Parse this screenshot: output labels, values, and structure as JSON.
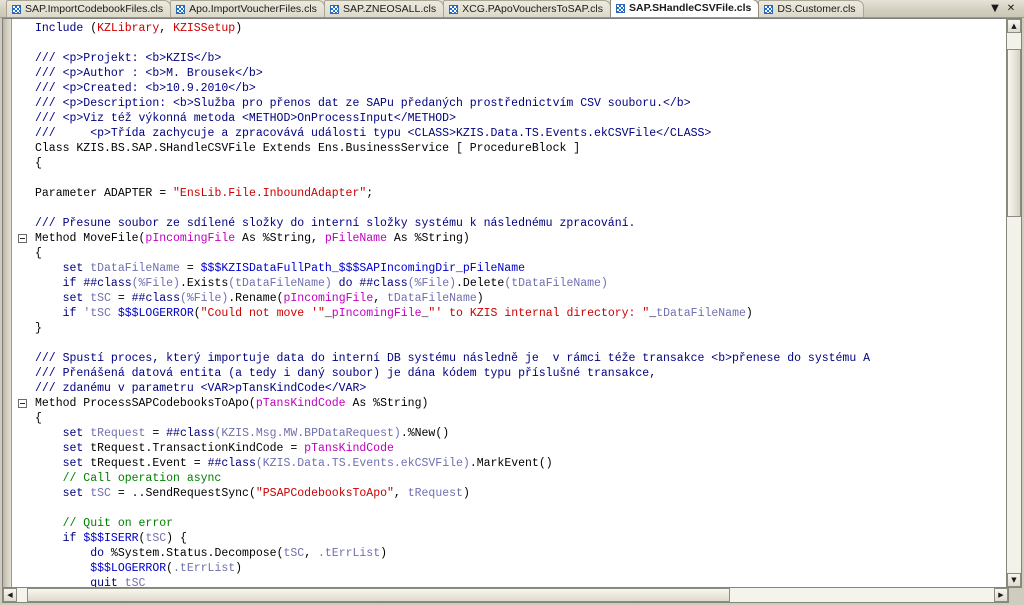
{
  "window": {
    "title": "SAP.SHandleCSVFile.cls"
  },
  "tabbar": {
    "tabs": [
      {
        "label": "SAP.ImportCodebookFiles.cls",
        "icon": "class-file-icon",
        "active": false
      },
      {
        "label": "Apo.ImportVoucherFiles.cls",
        "icon": "class-file-icon",
        "active": false
      },
      {
        "label": "SAP.ZNEOSALL.cls",
        "icon": "class-file-icon",
        "active": false
      },
      {
        "label": "XCG.PApoVouchersToSAP.cls",
        "icon": "class-file-icon",
        "active": false
      },
      {
        "label": "SAP.SHandleCSVFile.cls",
        "icon": "class-file-icon",
        "active": true
      },
      {
        "label": "DS.Customer.cls",
        "icon": "class-file-icon",
        "active": false
      }
    ],
    "tab_list_button": "▼",
    "close_button": "✕"
  },
  "scrollbars": {
    "vertical": {
      "up_arrow": "▲",
      "down_arrow": "▼",
      "thumb_top_pct": 3,
      "thumb_height_pct": 31
    },
    "horizontal": {
      "left_arrow": "◀",
      "right_arrow": "▶",
      "thumb_left_pct": 1,
      "thumb_width_pct": 72
    }
  },
  "colors": {
    "keyword": "#000080",
    "comment": "#008000",
    "doc_comment": "#000080",
    "string": "#cc0000",
    "macro": "#0000cc",
    "variable": "#c000c0",
    "classref": "#7070b0",
    "editor_background": "#ffffff",
    "chrome_background": "#d4d0c0",
    "active_tab_background": "#ffffff"
  },
  "code": {
    "language": "ObjectScript",
    "lines": [
      {
        "n": 1,
        "fold": false,
        "tokens": [
          {
            "t": "Include ",
            "c": "kw"
          },
          {
            "t": "(",
            "c": "plain"
          },
          {
            "t": "KZLibrary",
            "c": "str"
          },
          {
            "t": ", ",
            "c": "plain"
          },
          {
            "t": "KZISSetup",
            "c": "str"
          },
          {
            "t": ")",
            "c": "plain"
          }
        ]
      },
      {
        "n": 2,
        "fold": false,
        "tokens": []
      },
      {
        "n": 3,
        "fold": false,
        "tokens": [
          {
            "t": "/// <p>Projekt: <b>KZIS</b>",
            "c": "doc"
          }
        ]
      },
      {
        "n": 4,
        "fold": false,
        "tokens": [
          {
            "t": "/// <p>Author : <b>M. Brousek</b>",
            "c": "doc"
          }
        ]
      },
      {
        "n": 5,
        "fold": false,
        "tokens": [
          {
            "t": "/// <p>Created: <b>10.9.2010</b>",
            "c": "doc"
          }
        ]
      },
      {
        "n": 6,
        "fold": false,
        "tokens": [
          {
            "t": "/// <p>Description: <b>Služba pro přenos dat ze SAPu předaných prostřednictvím CSV souboru.</b>",
            "c": "doc"
          }
        ]
      },
      {
        "n": 7,
        "fold": false,
        "tokens": [
          {
            "t": "/// <p>Viz též výkonná metoda <METHOD>OnProcessInput</METHOD>",
            "c": "doc"
          }
        ]
      },
      {
        "n": 8,
        "fold": false,
        "tokens": [
          {
            "t": "///     <p>Třída zachycuje a zpracovává události typu <CLASS>KZIS.Data.TS.Events.ekCSVFile</CLASS>",
            "c": "doc"
          }
        ]
      },
      {
        "n": 9,
        "fold": false,
        "tokens": [
          {
            "t": "Class KZIS.BS.SAP.SHandleCSVFile Extends Ens.BusinessService [ ProcedureBlock ]",
            "c": "plain"
          }
        ]
      },
      {
        "n": 10,
        "fold": false,
        "tokens": [
          {
            "t": "{",
            "c": "plain"
          }
        ]
      },
      {
        "n": 11,
        "fold": false,
        "tokens": []
      },
      {
        "n": 12,
        "fold": false,
        "tokens": [
          {
            "t": "Parameter ADAPTER = ",
            "c": "plain"
          },
          {
            "t": "\"EnsLib.File.InboundAdapter\"",
            "c": "str"
          },
          {
            "t": ";",
            "c": "plain"
          }
        ]
      },
      {
        "n": 13,
        "fold": false,
        "tokens": []
      },
      {
        "n": 14,
        "fold": false,
        "tokens": [
          {
            "t": "/// Přesune soubor ze sdílené složky do interní složky systému k následnému zpracování.",
            "c": "doc"
          }
        ]
      },
      {
        "n": 15,
        "fold": true,
        "tokens": [
          {
            "t": "Method MoveFile(",
            "c": "plain"
          },
          {
            "t": "pIncomingFile",
            "c": "var"
          },
          {
            "t": " As %String, ",
            "c": "plain"
          },
          {
            "t": "pFileName",
            "c": "var"
          },
          {
            "t": " As %String)",
            "c": "plain"
          }
        ]
      },
      {
        "n": 16,
        "fold": false,
        "tokens": [
          {
            "t": "{",
            "c": "plain"
          }
        ]
      },
      {
        "n": 17,
        "fold": false,
        "tokens": [
          {
            "t": "    set ",
            "c": "kw"
          },
          {
            "t": "tDataFileName",
            "c": "cls"
          },
          {
            "t": " = ",
            "c": "plain"
          },
          {
            "t": "$$$KZISDataFullPath_$$$SAPIncomingDir_pFileName",
            "c": "mac"
          }
        ]
      },
      {
        "n": 18,
        "fold": false,
        "tokens": [
          {
            "t": "    if ",
            "c": "kw"
          },
          {
            "t": "##class",
            "c": "kw"
          },
          {
            "t": "(%File)",
            "c": "cls"
          },
          {
            "t": ".Exists",
            "c": "plain"
          },
          {
            "t": "(tDataFileName)",
            "c": "cls"
          },
          {
            "t": " do ",
            "c": "kw"
          },
          {
            "t": "##class",
            "c": "kw"
          },
          {
            "t": "(%File)",
            "c": "cls"
          },
          {
            "t": ".Delete",
            "c": "plain"
          },
          {
            "t": "(tDataFileName)",
            "c": "cls"
          }
        ]
      },
      {
        "n": 19,
        "fold": false,
        "tokens": [
          {
            "t": "    set ",
            "c": "kw"
          },
          {
            "t": "tSC",
            "c": "cls"
          },
          {
            "t": " = ",
            "c": "plain"
          },
          {
            "t": "##class",
            "c": "kw"
          },
          {
            "t": "(%File)",
            "c": "cls"
          },
          {
            "t": ".Rename",
            "c": "plain"
          },
          {
            "t": "(",
            "c": "plain"
          },
          {
            "t": "pIncomingFile",
            "c": "var"
          },
          {
            "t": ", ",
            "c": "plain"
          },
          {
            "t": "tDataFileName",
            "c": "cls"
          },
          {
            "t": ")",
            "c": "plain"
          }
        ]
      },
      {
        "n": 20,
        "fold": false,
        "tokens": [
          {
            "t": "    if ",
            "c": "kw"
          },
          {
            "t": "'tSC ",
            "c": "cls"
          },
          {
            "t": "$$$LOGERROR",
            "c": "mac"
          },
          {
            "t": "(",
            "c": "plain"
          },
          {
            "t": "\"Could not move '\"",
            "c": "str"
          },
          {
            "t": "_",
            "c": "plain"
          },
          {
            "t": "pIncomingFile",
            "c": "var"
          },
          {
            "t": "_",
            "c": "plain"
          },
          {
            "t": "\"' to KZIS internal directory: \"",
            "c": "str"
          },
          {
            "t": "_",
            "c": "plain"
          },
          {
            "t": "tDataFileName",
            "c": "cls"
          },
          {
            "t": ")",
            "c": "plain"
          }
        ]
      },
      {
        "n": 21,
        "fold": false,
        "tokens": [
          {
            "t": "}",
            "c": "plain"
          }
        ]
      },
      {
        "n": 22,
        "fold": false,
        "tokens": []
      },
      {
        "n": 23,
        "fold": false,
        "tokens": [
          {
            "t": "/// Spustí proces, který importuje data do interní DB systému následně je  v rámci téže transakce <b>přenese do systému A",
            "c": "doc"
          }
        ]
      },
      {
        "n": 24,
        "fold": false,
        "tokens": [
          {
            "t": "/// Přenášená datová entita (a tedy i daný soubor) je dána kódem typu příslušné transakce,",
            "c": "doc"
          }
        ]
      },
      {
        "n": 25,
        "fold": false,
        "tokens": [
          {
            "t": "/// zdanému v parametru <VAR>pTansKindCode</VAR>",
            "c": "doc"
          }
        ]
      },
      {
        "n": 26,
        "fold": true,
        "tokens": [
          {
            "t": "Method ProcessSAPCodebooksToApo(",
            "c": "plain"
          },
          {
            "t": "pTansKindCode",
            "c": "var"
          },
          {
            "t": " As %String)",
            "c": "plain"
          }
        ]
      },
      {
        "n": 27,
        "fold": false,
        "tokens": [
          {
            "t": "{",
            "c": "plain"
          }
        ]
      },
      {
        "n": 28,
        "fold": false,
        "tokens": [
          {
            "t": "    set ",
            "c": "kw"
          },
          {
            "t": "tRequest",
            "c": "cls"
          },
          {
            "t": " = ",
            "c": "plain"
          },
          {
            "t": "##class",
            "c": "kw"
          },
          {
            "t": "(KZIS.Msg.MW.BPDataRequest)",
            "c": "cls"
          },
          {
            "t": ".%New()",
            "c": "plain"
          }
        ]
      },
      {
        "n": 29,
        "fold": false,
        "tokens": [
          {
            "t": "    set ",
            "c": "kw"
          },
          {
            "t": "tRequest.TransactionKindCode",
            "c": "plain"
          },
          {
            "t": " = ",
            "c": "plain"
          },
          {
            "t": "pTansKindCode",
            "c": "var"
          }
        ]
      },
      {
        "n": 30,
        "fold": false,
        "tokens": [
          {
            "t": "    set ",
            "c": "kw"
          },
          {
            "t": "tRequest.Event",
            "c": "plain"
          },
          {
            "t": " = ",
            "c": "plain"
          },
          {
            "t": "##class",
            "c": "kw"
          },
          {
            "t": "(KZIS.Data.TS.Events.ekCSVFile)",
            "c": "cls"
          },
          {
            "t": ".MarkEvent()",
            "c": "plain"
          }
        ]
      },
      {
        "n": 31,
        "fold": false,
        "tokens": [
          {
            "t": "    // Call operation async",
            "c": "cmt"
          }
        ]
      },
      {
        "n": 32,
        "fold": false,
        "tokens": [
          {
            "t": "    set ",
            "c": "kw"
          },
          {
            "t": "tSC",
            "c": "cls"
          },
          {
            "t": " = ..SendRequestSync(",
            "c": "plain"
          },
          {
            "t": "\"PSAPCodebooksToApo\"",
            "c": "str"
          },
          {
            "t": ", ",
            "c": "plain"
          },
          {
            "t": "tRequest",
            "c": "cls"
          },
          {
            "t": ")",
            "c": "plain"
          }
        ]
      },
      {
        "n": 33,
        "fold": false,
        "tokens": []
      },
      {
        "n": 34,
        "fold": false,
        "tokens": [
          {
            "t": "    // Quit on error",
            "c": "cmt"
          }
        ]
      },
      {
        "n": 35,
        "fold": false,
        "tokens": [
          {
            "t": "    if ",
            "c": "kw"
          },
          {
            "t": "$$$ISERR",
            "c": "mac"
          },
          {
            "t": "(",
            "c": "plain"
          },
          {
            "t": "tSC",
            "c": "cls"
          },
          {
            "t": ") {",
            "c": "plain"
          }
        ]
      },
      {
        "n": 36,
        "fold": false,
        "tokens": [
          {
            "t": "        do ",
            "c": "kw"
          },
          {
            "t": "%System.Status.Decompose",
            "c": "plain"
          },
          {
            "t": "(",
            "c": "plain"
          },
          {
            "t": "tSC",
            "c": "cls"
          },
          {
            "t": ", ",
            "c": "plain"
          },
          {
            "t": ".tErrList",
            "c": "cls"
          },
          {
            "t": ")",
            "c": "plain"
          }
        ]
      },
      {
        "n": 37,
        "fold": false,
        "tokens": [
          {
            "t": "        $$$LOGERROR",
            "c": "mac"
          },
          {
            "t": "(",
            "c": "plain"
          },
          {
            "t": ".tErrList",
            "c": "cls"
          },
          {
            "t": ")",
            "c": "plain"
          }
        ]
      },
      {
        "n": 38,
        "fold": false,
        "tokens": [
          {
            "t": "        quit ",
            "c": "kw"
          },
          {
            "t": "tSC",
            "c": "cls"
          }
        ]
      },
      {
        "n": 39,
        "fold": false,
        "tokens": [
          {
            "t": "    }",
            "c": "plain"
          }
        ]
      }
    ]
  }
}
